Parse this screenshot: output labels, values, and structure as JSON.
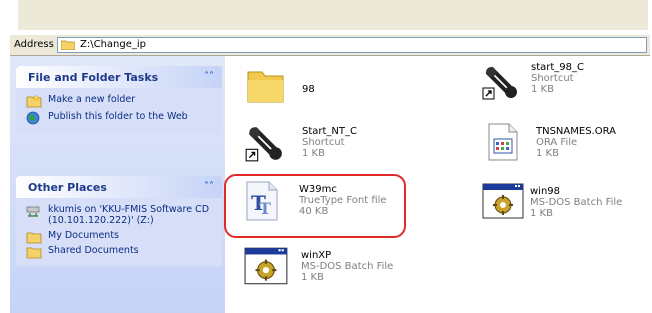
{
  "address": {
    "label": "Address",
    "path": "Z:\\Change_ip"
  },
  "panels": {
    "file_tasks": {
      "title": "File and Folder Tasks",
      "items": [
        {
          "label": "Make a new folder",
          "icon": "new-folder-icon"
        },
        {
          "label": "Publish this folder to the Web",
          "icon": "web-publish-icon"
        }
      ]
    },
    "other_places": {
      "title": "Other Places",
      "items": [
        {
          "label": "kkumis on 'KKU-FMIS Software CD (10.101.120.222)' (Z:)",
          "icon": "network-drive-icon"
        },
        {
          "label": "My Documents",
          "icon": "folder-icon"
        },
        {
          "label": "Shared Documents",
          "icon": "folder-icon"
        }
      ]
    }
  },
  "files": [
    {
      "name": "98",
      "type": "",
      "size": "",
      "icon": "folder-icon"
    },
    {
      "name": "start_98_C",
      "type": "Shortcut",
      "size": "1 KB",
      "icon": "shortcut-icon"
    },
    {
      "name": "Start_NT_C",
      "type": "Shortcut",
      "size": "1 KB",
      "icon": "shortcut-icon"
    },
    {
      "name": "TNSNAMES.ORA",
      "type": "ORA File",
      "size": "1 KB",
      "icon": "ora-file-icon"
    },
    {
      "name": "W39mc",
      "type": "TrueType Font file",
      "size": "40 KB",
      "icon": "truetype-font-icon"
    },
    {
      "name": "win98",
      "type": "MS-DOS Batch File",
      "size": "1 KB",
      "icon": "batch-file-icon"
    },
    {
      "name": "winXP",
      "type": "MS-DOS Batch File",
      "size": "1 KB",
      "icon": "batch-file-icon"
    }
  ],
  "colors": {
    "highlight": "#e02a2a",
    "sidebar": "#d6dff7",
    "link": "#0c2d83"
  }
}
